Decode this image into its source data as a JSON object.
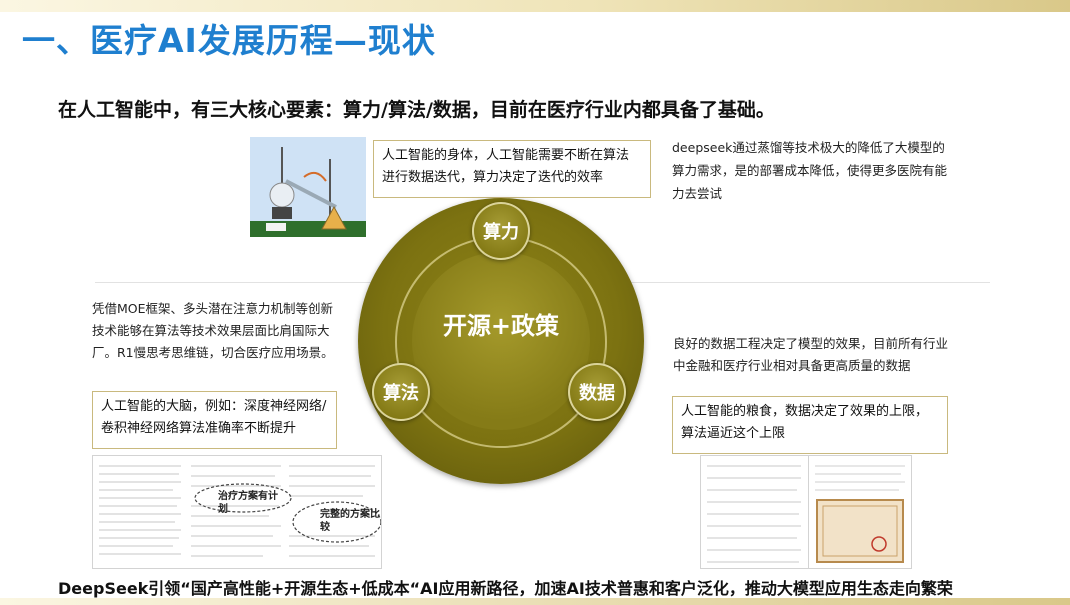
{
  "title": "一、医疗AI发展历程—现状",
  "subtitle": "在人工智能中，有三大核心要素：算力/算法/数据，目前在医疗行业内都具备了基础。",
  "diagram": {
    "center": "开源+政策",
    "nodes": {
      "compute": "算力",
      "algorithm": "算法",
      "data": "数据"
    }
  },
  "compute": {
    "box": "人工智能的身体，人工智能需要不断在算法 进行数据迭代，算力决定了迭代的效率",
    "note": "deepseek通过蒸馏等技术极大的降低了大模型的算力需求，是的部署成本降低，使得更多医院有能力去尝试"
  },
  "algorithm": {
    "note": "凭借MOE框架、多头潜在注意力机制等创新技术能够在算法等技术效果层面比肩国际大厂。R1慢思考思维链，切合医疗应用场景。",
    "box": "人工智能的大脑，例如：深度神经网络/卷积神经网络算法准确率不断提升"
  },
  "data": {
    "note": "良好的数据工程决定了模型的效果，目前所有行业中金融和医疗行业相对具备更高质量的数据",
    "box": "人工智能的粮食，数据决定了效果的上限，算法逼近这个上限"
  },
  "doc_annotations": {
    "a": "治疗方案有计划",
    "b": "完整的方案比较"
  },
  "footer": "DeepSeek引领“国产高性能+开源生态+低成本“AI应用新路径，加速AI技术普惠和客户泛化，推动大模型应用生态走向繁荣"
}
